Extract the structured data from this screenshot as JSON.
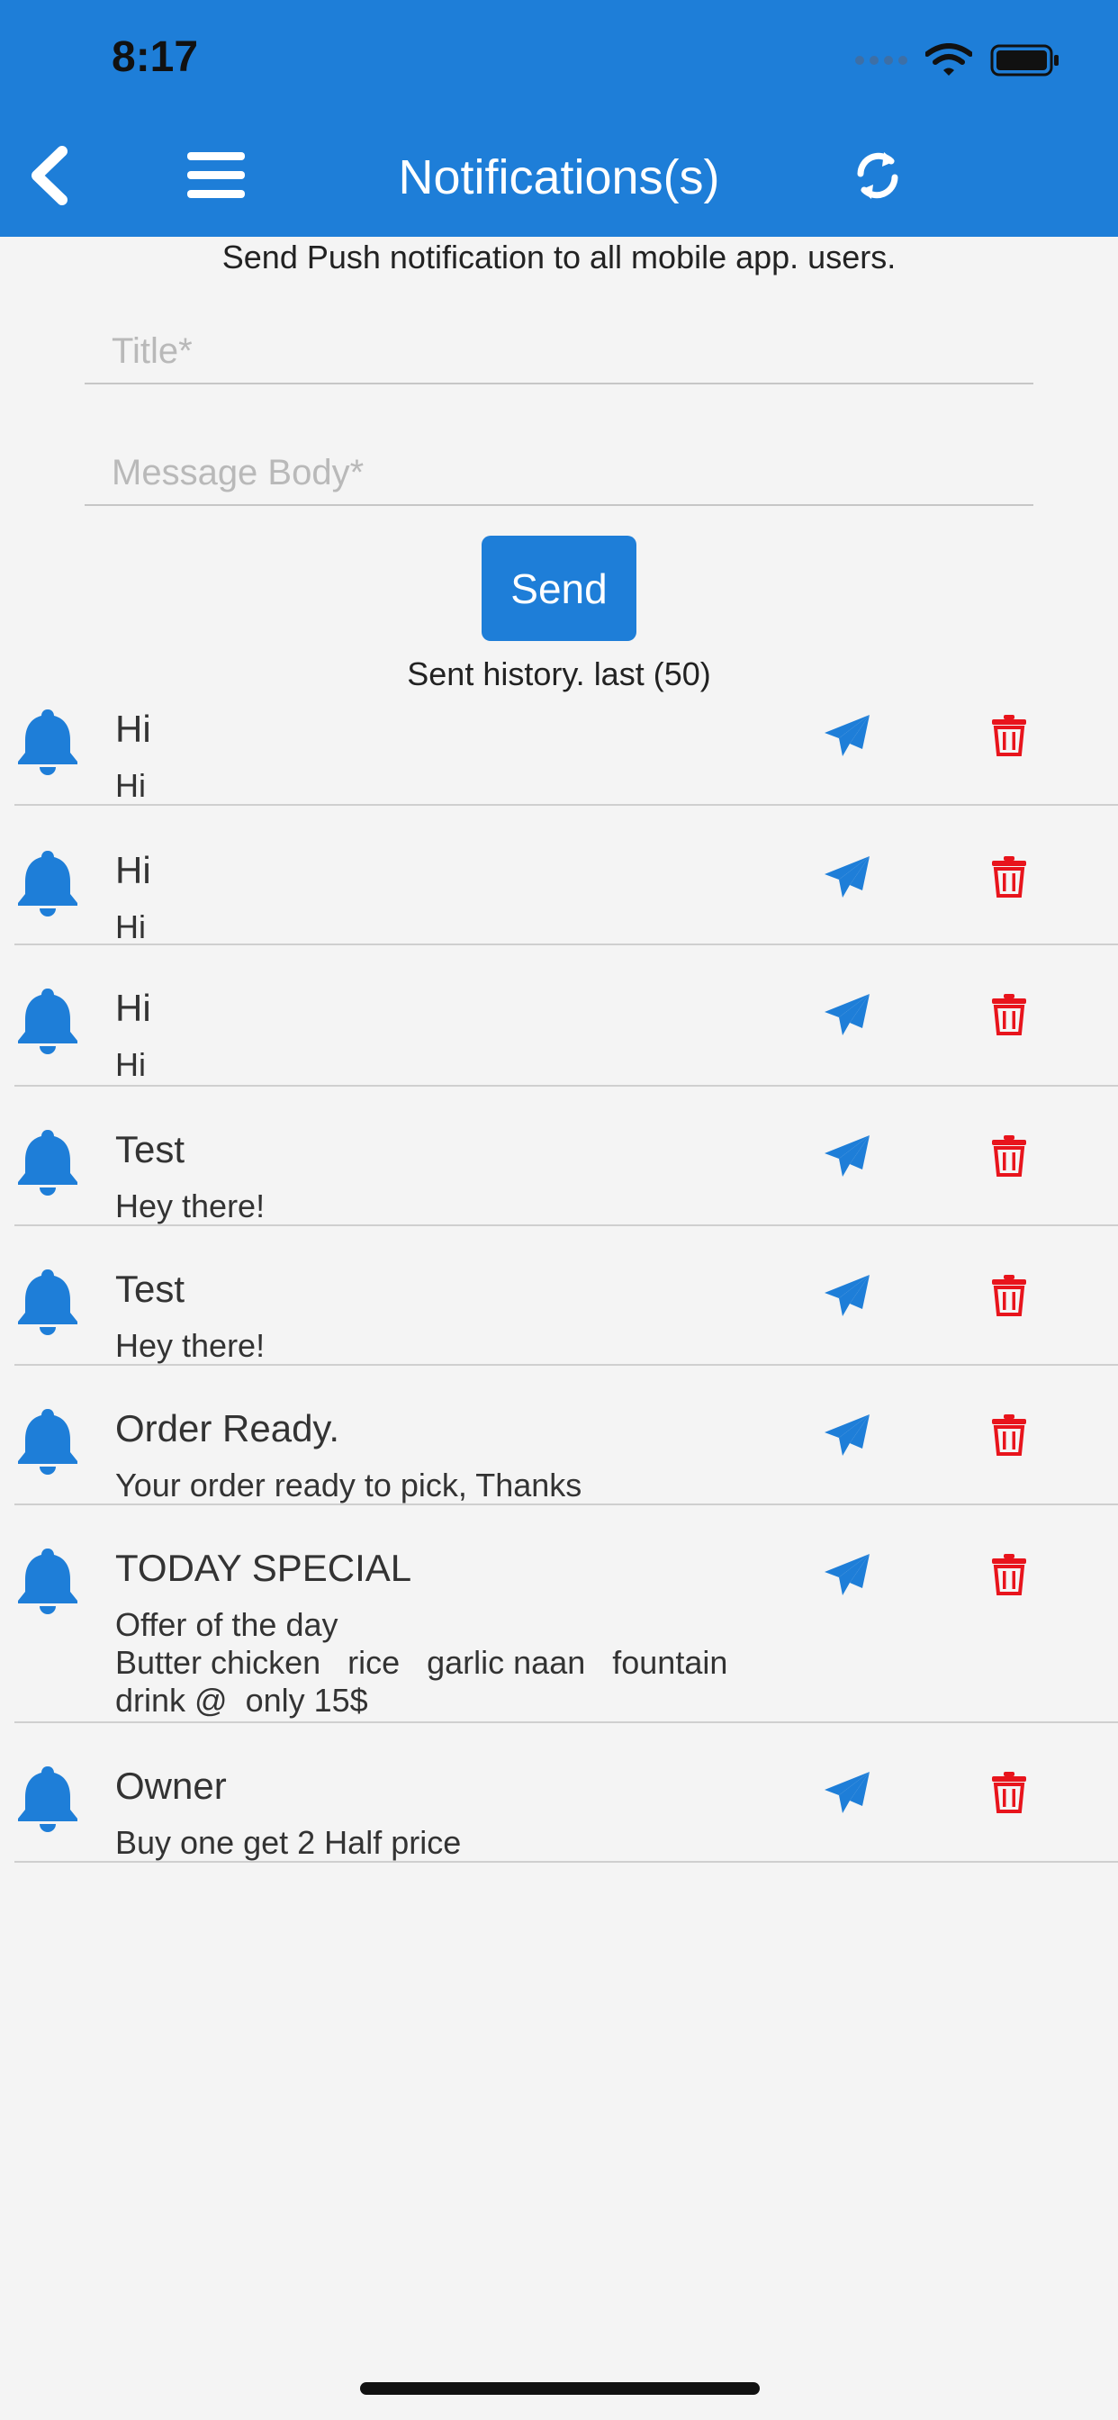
{
  "status_bar": {
    "time": "8:17"
  },
  "header": {
    "title": "Notifications(s)"
  },
  "form": {
    "subtitle": "Send Push notification to all mobile app. users.",
    "title_placeholder": "Title*",
    "body_placeholder": "Message Body*",
    "send_label": "Send"
  },
  "history": {
    "label": "Sent history. last (50)",
    "items": [
      {
        "title": "Hi",
        "body": "Hi"
      },
      {
        "title": "Hi",
        "body": "Hi"
      },
      {
        "title": "Hi",
        "body": "Hi"
      },
      {
        "title": "Test",
        "body": "Hey there!"
      },
      {
        "title": "Test",
        "body": "Hey there!"
      },
      {
        "title": "Order Ready.",
        "body": "Your order ready to pick, Thanks"
      },
      {
        "title": "TODAY SPECIAL",
        "body": "Offer of the day\nButter chicken   rice   garlic naan   fountain\ndrink @  only 15$"
      },
      {
        "title": "Owner",
        "body": "Buy one get 2 Half price"
      }
    ]
  },
  "colors": {
    "primary": "#1e7ed8",
    "delete": "#e8141c",
    "background": "#f4f4f4"
  },
  "icons": {
    "back": "chevron-left-icon",
    "menu": "hamburger-icon",
    "refresh": "refresh-icon",
    "bell": "bell-icon",
    "send_again": "paper-plane-icon",
    "delete": "trash-icon"
  }
}
